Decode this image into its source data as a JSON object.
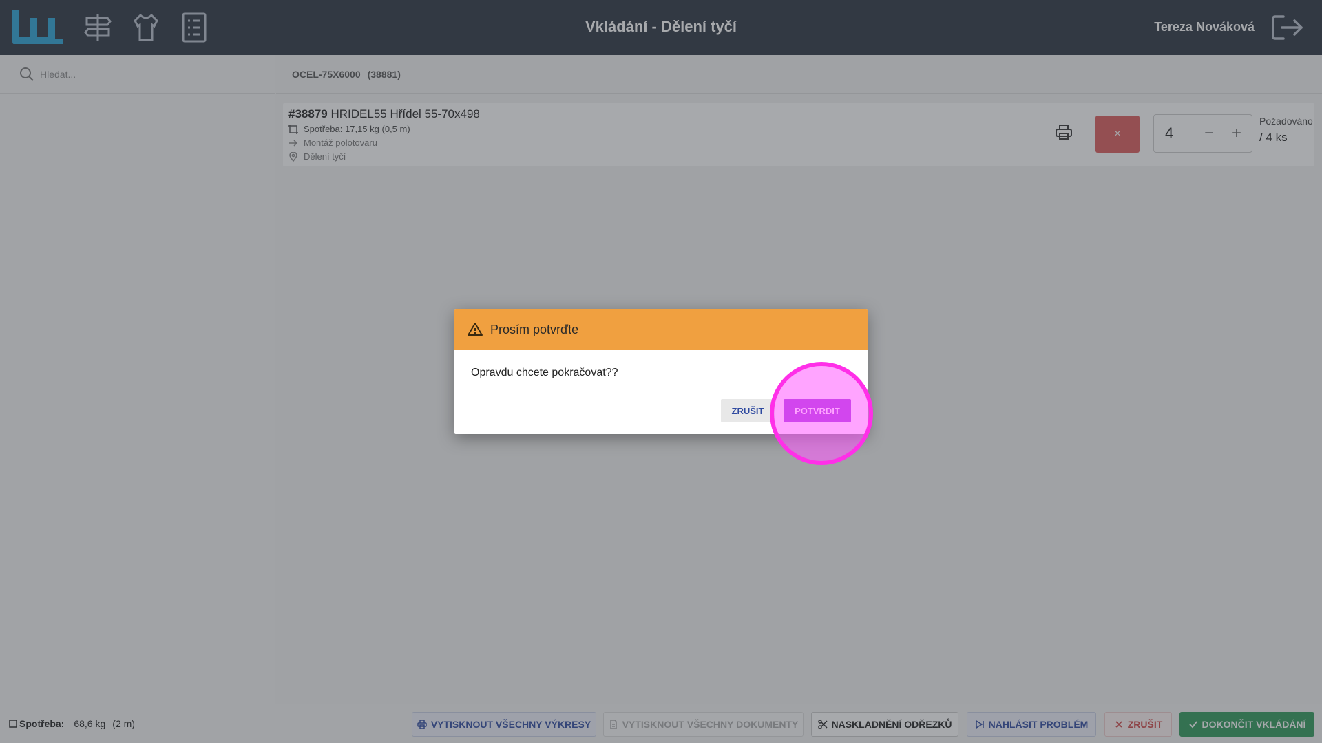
{
  "header": {
    "title": "Vkládání - Dělení tyčí",
    "user_name": "Tereza Nováková",
    "nav_icons": [
      "signpost-icon",
      "shirt-icon",
      "list-icon"
    ],
    "logout_icon": "logout-icon"
  },
  "search": {
    "placeholder": "Hledat..."
  },
  "material": {
    "code": "OCEL-75X6000",
    "id": "(38881)"
  },
  "item": {
    "number": "#38879",
    "name": "HRIDEL55 Hřídel 55-70x498",
    "consumption_label": "Spotřeba:",
    "consumption_value": "17,15 kg (0,5 m)",
    "next_step": "Montáž polotovaru",
    "location": "Dělení tyčí",
    "remove_label": "×",
    "quantity": "4",
    "minus_label": "−",
    "plus_label": "+",
    "requested_label": "Požadováno",
    "requested_value": "/ 4 ks"
  },
  "footer": {
    "consumption_label": "Spotřeba:",
    "consumption_weight": "68,6 kg",
    "consumption_length": "(2 m)",
    "buttons": {
      "print_drawings": "VYTISKNOUT VŠECHNY VÝKRESY",
      "print_documents": "VYTISKNOUT VŠECHNY DOKUMENTY",
      "store_offcuts": "NASKLADNĚNÍ ODŘEZKŮ",
      "report_problem": "NAHLÁSIT PROBLÉM",
      "cancel": "ZRUŠIT",
      "finish": "DOKONČIT VKLÁDÁNÍ"
    }
  },
  "dialog": {
    "title": "Prosím potvrďte",
    "message": "Opravdu chcete pokračovat??",
    "cancel_label": "ZRUŠIT",
    "confirm_label": "POTVRDIT"
  },
  "colors": {
    "header_bg": "#2b3340",
    "dialog_header": "#f0a040",
    "confirm_button": "#9b30d9",
    "remove_button": "#dc5b5b",
    "finish_button": "#2e9a5a",
    "logo": "#2aa4d8"
  }
}
